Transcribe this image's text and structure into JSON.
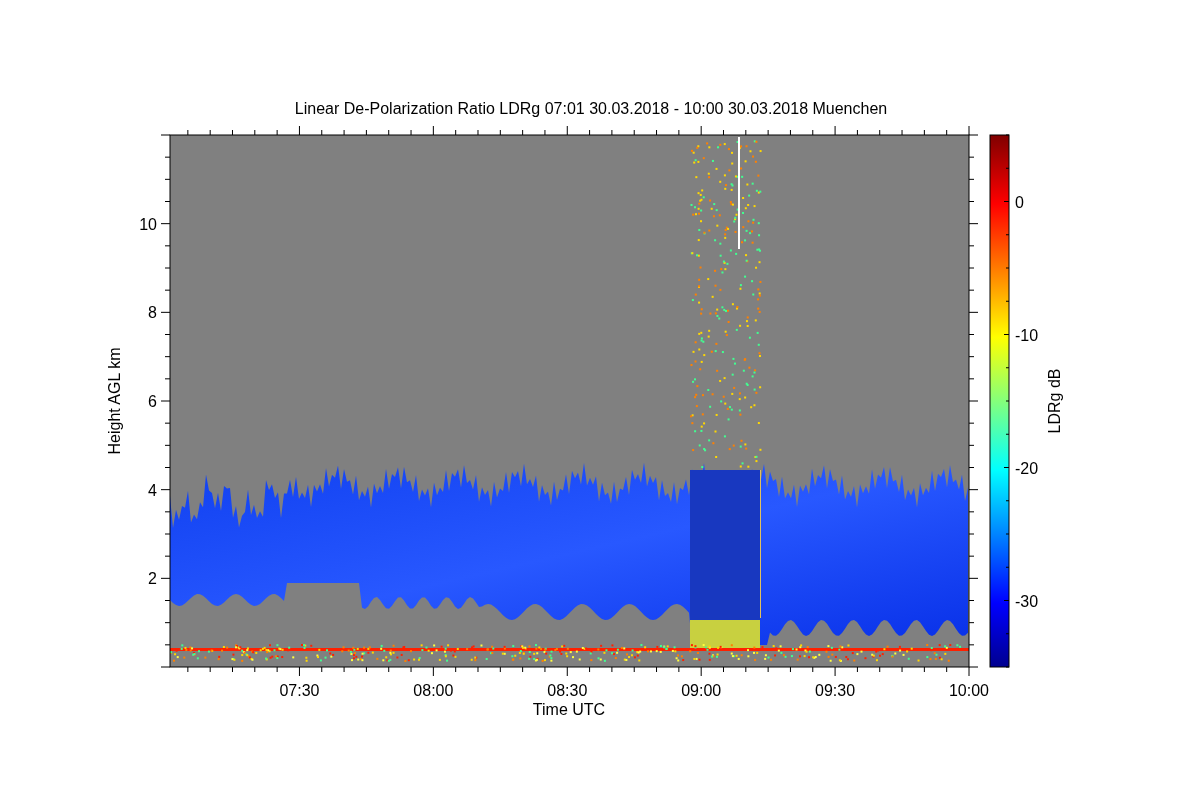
{
  "plot": {
    "title": "Linear De-Polarization Ratio LDRg   07:01 30.03.2018 - 10:00 30.03.2018 Muenchen",
    "xlabel": "Time UTC",
    "ylabel": "Height AGL km",
    "xticks": [
      "07:30",
      "08:00",
      "08:30",
      "09:00",
      "09:30",
      "10:00"
    ],
    "yticks": [
      "10",
      "8",
      "6",
      "4",
      "2"
    ],
    "colorbar": {
      "label": "LDRg dB",
      "ticks": [
        "0",
        "-10",
        "-20",
        "-30"
      ]
    }
  }
}
